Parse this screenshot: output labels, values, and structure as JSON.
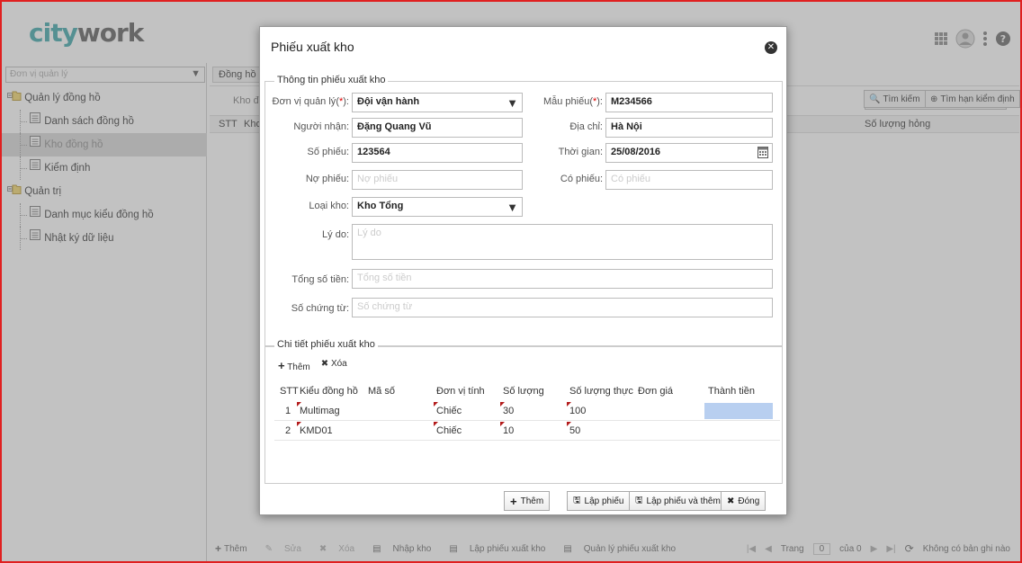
{
  "app": {
    "logo_part1": "city",
    "logo_part2": "work"
  },
  "sidebar": {
    "select_placeholder": "Đơn vị quản lý",
    "tree": [
      {
        "label": "Quản lý đồng hồ",
        "level": 0,
        "type": "folder"
      },
      {
        "label": "Danh sách đồng hồ",
        "level": 1,
        "type": "page"
      },
      {
        "label": "Kho đồng hồ",
        "level": 1,
        "type": "page",
        "selected": true
      },
      {
        "label": "Kiểm định",
        "level": 1,
        "type": "page"
      },
      {
        "label": "Quản trị",
        "level": 0,
        "type": "folder"
      },
      {
        "label": "Danh mục kiểu đồng hồ",
        "level": 1,
        "type": "page"
      },
      {
        "label": "Nhật ký dữ liệu",
        "level": 1,
        "type": "page"
      }
    ]
  },
  "background": {
    "tab_label": "Đồng hồ",
    "filter_label": "Kho đ",
    "col_stt": "STT",
    "col_kho": "Kho",
    "col_soluonghong": "Số lượng hỏng",
    "btn_search": "Tìm kiếm",
    "btn_search_due": "Tìm hạn kiểm định",
    "bottom": {
      "them": "Thêm",
      "sua": "Sửa",
      "xoa": "Xóa",
      "nhapkho": "Nhập kho",
      "lapphieu": "Lập phiếu xuất kho",
      "quanly": "Quản lý phiếu xuất kho",
      "trang": "Trang",
      "page_value": "0",
      "cua": "của 0",
      "norecord": "Không có bản ghi nào"
    }
  },
  "modal": {
    "title": "Phiếu xuất kho",
    "info_legend": "Thông tin phiếu xuất kho",
    "fields": {
      "donvi_label": "Đơn vị quản lý",
      "donvi_value": "Đội vận hành",
      "mau_label": "Mẫu phiếu",
      "mau_value": "M234566",
      "nguoinhan_label": "Người nhận:",
      "nguoinhan_value": "Đặng Quang Vũ",
      "diachi_label": "Địa chỉ:",
      "diachi_value": "Hà Nội",
      "sophieu_label": "Số phiếu:",
      "sophieu_value": "123564",
      "thoigian_label": "Thời gian:",
      "thoigian_value": "25/08/2016",
      "nophieu_label": "Nợ phiếu:",
      "nophieu_placeholder": "Nợ phiếu",
      "cophieu_label": "Có phiếu:",
      "cophieu_placeholder": "Có phiếu",
      "loaikho_label": "Loại kho:",
      "loaikho_value": "Kho Tổng",
      "lydo_label": "Lý do:",
      "lydo_placeholder": "Lý do",
      "tongtien_label": "Tổng số tiền:",
      "tongtien_placeholder": "Tổng số tiền",
      "chungtu_label": "Số chứng từ:",
      "chungtu_placeholder": "Số chứng từ"
    },
    "detail_legend": "Chi tiết phiếu xuất kho",
    "detail_toolbar": {
      "add": "Thêm",
      "delete": "Xóa"
    },
    "columns": [
      "STT",
      "Kiểu đồng hồ",
      "Mã số",
      "Đơn vị tính",
      "Số lượng",
      "Số lượng thực",
      "Đơn giá",
      "Thành tiền"
    ],
    "rows": [
      {
        "stt": "1",
        "kieu": "Multimag",
        "ma": "",
        "dvt": "Chiếc",
        "sl": "30",
        "slt": "100",
        "dongia": "",
        "thanhtien": ""
      },
      {
        "stt": "2",
        "kieu": "KMD01",
        "ma": "",
        "dvt": "Chiếc",
        "sl": "10",
        "slt": "50",
        "dongia": "",
        "thanhtien": ""
      }
    ],
    "buttons": {
      "them": "Thêm",
      "lapphieu": "Lập phiếu",
      "lapphieuthem": "Lập phiếu và thêm",
      "dong": "Đóng"
    }
  },
  "colors": {
    "frame": "#e02020",
    "logo_primary": "#3aa5a8",
    "logo_secondary": "#5a5a5a",
    "selected_cell": "#b8cff0"
  }
}
